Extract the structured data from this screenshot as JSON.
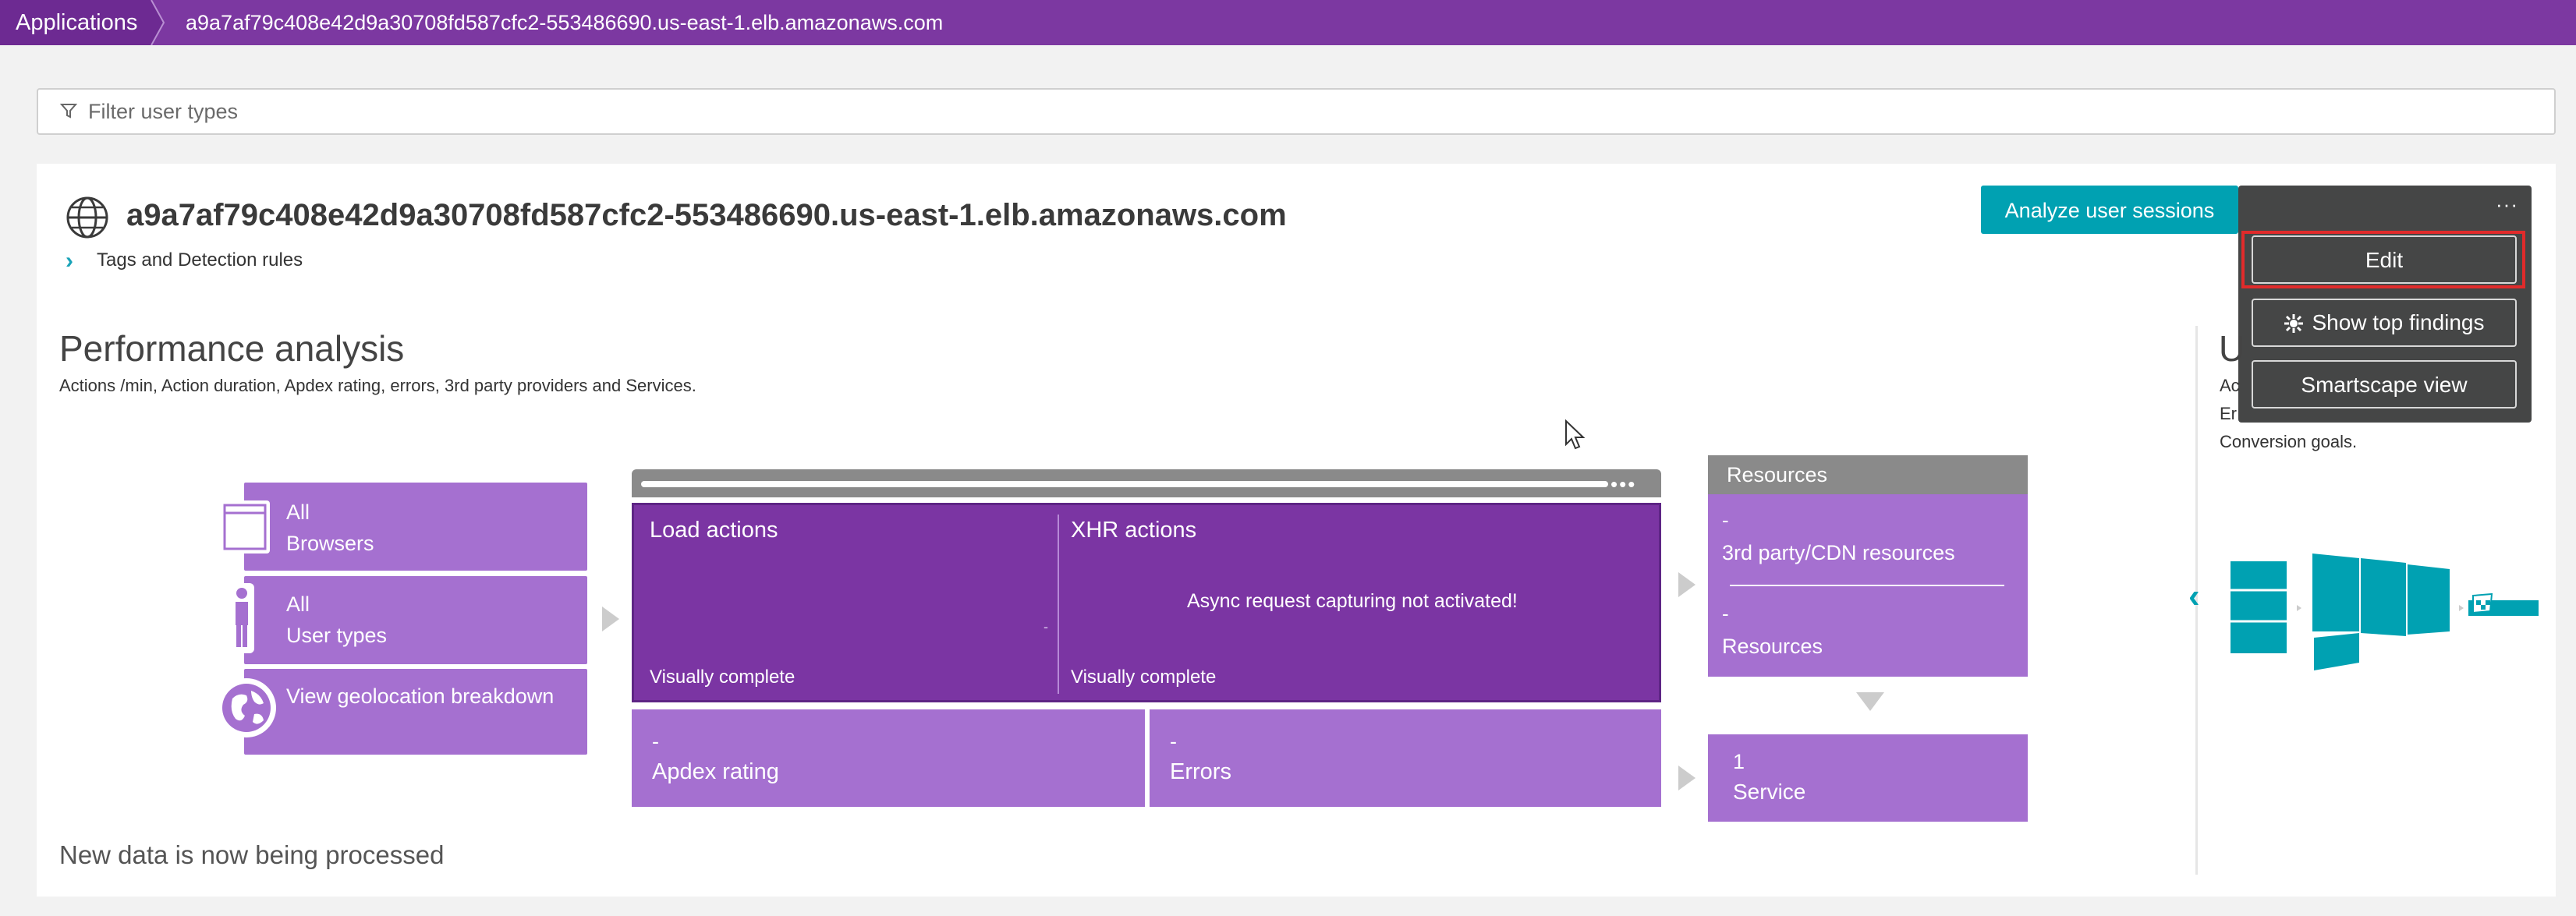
{
  "breadcrumb": {
    "home": "Applications",
    "current": "a9a7af79c408e42d9a30708fd587cfc2-553486690.us-east-1.elb.amazonaws.com"
  },
  "filter": {
    "placeholder": "Filter user types",
    "value": ""
  },
  "app": {
    "title": "a9a7af79c408e42d9a30708fd587cfc2-553486690.us-east-1.elb.amazonaws.com",
    "tags_link": "Tags and Detection rules"
  },
  "actions": {
    "analyze": "Analyze user sessions",
    "menu_dots": "···",
    "menu": {
      "edit": "Edit",
      "top_findings": "Show top findings",
      "smartscape": "Smartscape view"
    }
  },
  "performance": {
    "title": "Performance analysis",
    "subtitle": "Actions /min, Action duration, Apdex rating, errors, 3rd party providers and Services.",
    "browsers": {
      "line1": "All",
      "line2": "Browsers"
    },
    "user_types": {
      "line1": "All",
      "line2": "User types"
    },
    "geo": "View geolocation breakdown",
    "load_actions": {
      "label": "Load actions",
      "value": "-",
      "metric": "Visually complete"
    },
    "xhr_actions": {
      "label": "XHR actions",
      "message": "Async request capturing not activated!",
      "metric": "Visually complete"
    },
    "apdex": {
      "value": "-",
      "label": "Apdex rating"
    },
    "errors": {
      "value": "-",
      "label": "Errors"
    },
    "resources": {
      "header": "Resources",
      "third_party_value": "-",
      "third_party_label": "3rd party/CDN resources",
      "resources_value": "-",
      "resources_label": "Resources"
    },
    "service": {
      "value": "1",
      "label": "Service"
    },
    "status": "New data is now being processed"
  },
  "right_panel": {
    "title_fragment": "U",
    "line1": "Ac",
    "line2": "Er",
    "line3": "Conversion goals."
  },
  "colors": {
    "topbar": "#7c38a1",
    "accent": "#00a1b2",
    "tile": "#a570d0",
    "tile_dark": "#7b35a3",
    "menu": "#454646",
    "highlight": "#e02b2b"
  },
  "icons": [
    "filter-icon",
    "globe-icon",
    "chevron-right-icon",
    "browser-window-icon",
    "user-icon",
    "world-icon",
    "sparkle-icon",
    "chevron-left-icon",
    "funnel-icon",
    "mouse-cursor-icon"
  ]
}
